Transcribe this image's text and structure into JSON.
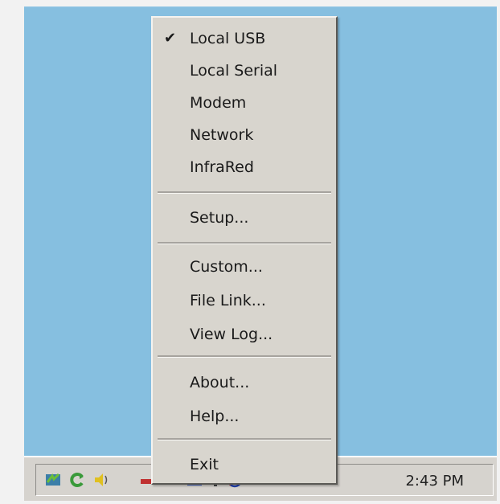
{
  "menu": {
    "items": [
      {
        "label": "Local USB",
        "checked": true
      },
      {
        "label": "Local Serial"
      },
      {
        "label": "Modem"
      },
      {
        "label": "Network"
      },
      {
        "label": "InfraRed"
      },
      {
        "label": "Setup..."
      },
      {
        "label": "Custom..."
      },
      {
        "label": "File Link..."
      },
      {
        "label": "View Log..."
      },
      {
        "label": "About..."
      },
      {
        "label": "Help..."
      },
      {
        "label": "Exit"
      }
    ],
    "check_mark": "✔"
  },
  "taskbar": {
    "clock": "2:43 PM",
    "tray_icons": [
      "sync-icon",
      "refresh-icon",
      "volume-icon",
      "network-icon",
      "battery-icon",
      "printer-icon",
      "display-icon",
      "shield-icon"
    ]
  },
  "colors": {
    "desktop": "#86bfe0",
    "menu_bg": "#d8d5ce",
    "taskbar_bg": "#d6d3ce"
  }
}
